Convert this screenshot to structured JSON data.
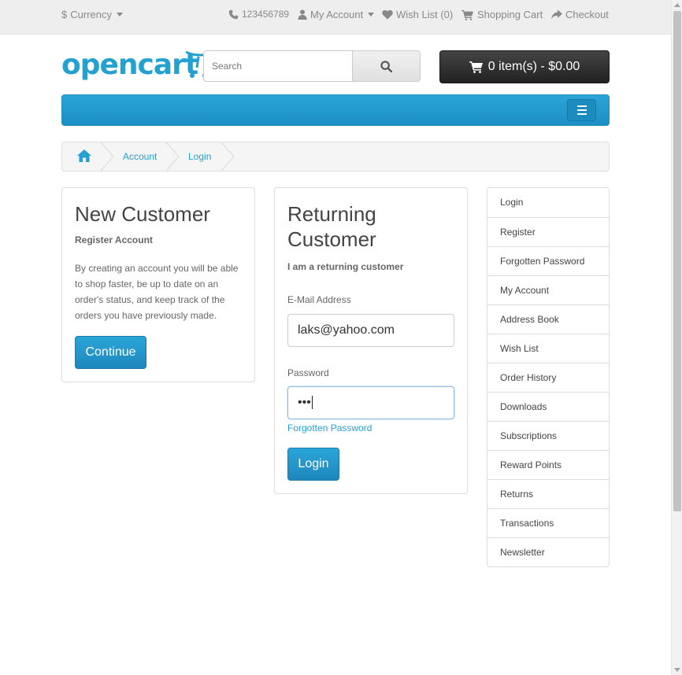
{
  "top_bar": {
    "currency_symbol": "$",
    "currency_label": "Currency",
    "phone": "123456789",
    "my_account": "My Account",
    "wishlist": "Wish List (0)",
    "shopping_cart": "Shopping Cart",
    "checkout": "Checkout"
  },
  "header": {
    "logo_text": "opencart",
    "search_placeholder": "Search",
    "cart_label": "0 item(s) - $0.00"
  },
  "breadcrumb": {
    "items": [
      "Account",
      "Login"
    ]
  },
  "new_customer": {
    "title": "New Customer",
    "subtitle": "Register Account",
    "description": "By creating an account you will be able to shop faster, be up to date on an order's status, and keep track of the orders you have previously made.",
    "button": "Continue"
  },
  "returning_customer": {
    "title_line1": "Returning",
    "title_line2": "Customer",
    "subtitle": "I am a returning customer",
    "email_label": "E-Mail Address",
    "email_value": "laks@yahoo.com",
    "password_label": "Password",
    "password_value": "•••",
    "forgotten_link": "Forgotten Password",
    "button": "Login"
  },
  "account_menu": {
    "items": [
      "Login",
      "Register",
      "Forgotten Password",
      "My Account",
      "Address Book",
      "Wish List",
      "Order History",
      "Downloads",
      "Subscriptions",
      "Reward Points",
      "Returns",
      "Transactions",
      "Newsletter"
    ]
  },
  "colors": {
    "brand_blue": "#23a1d1",
    "cart_dark": "#222222"
  }
}
